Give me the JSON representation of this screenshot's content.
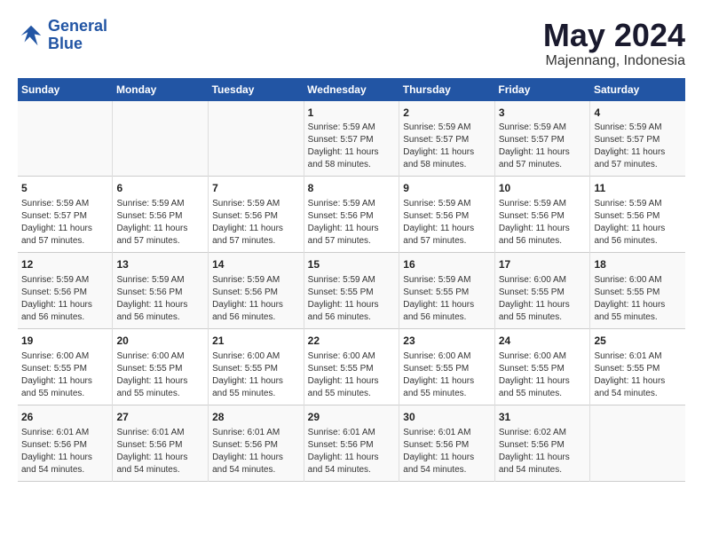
{
  "header": {
    "logo_line1": "General",
    "logo_line2": "Blue",
    "month_title": "May 2024",
    "location": "Majennang, Indonesia"
  },
  "weekdays": [
    "Sunday",
    "Monday",
    "Tuesday",
    "Wednesday",
    "Thursday",
    "Friday",
    "Saturday"
  ],
  "weeks": [
    {
      "cells": [
        {
          "day": "",
          "info": ""
        },
        {
          "day": "",
          "info": ""
        },
        {
          "day": "",
          "info": ""
        },
        {
          "day": "1",
          "info": "Sunrise: 5:59 AM\nSunset: 5:57 PM\nDaylight: 11 hours\nand 58 minutes."
        },
        {
          "day": "2",
          "info": "Sunrise: 5:59 AM\nSunset: 5:57 PM\nDaylight: 11 hours\nand 58 minutes."
        },
        {
          "day": "3",
          "info": "Sunrise: 5:59 AM\nSunset: 5:57 PM\nDaylight: 11 hours\nand 57 minutes."
        },
        {
          "day": "4",
          "info": "Sunrise: 5:59 AM\nSunset: 5:57 PM\nDaylight: 11 hours\nand 57 minutes."
        }
      ]
    },
    {
      "cells": [
        {
          "day": "5",
          "info": "Sunrise: 5:59 AM\nSunset: 5:57 PM\nDaylight: 11 hours\nand 57 minutes."
        },
        {
          "day": "6",
          "info": "Sunrise: 5:59 AM\nSunset: 5:56 PM\nDaylight: 11 hours\nand 57 minutes."
        },
        {
          "day": "7",
          "info": "Sunrise: 5:59 AM\nSunset: 5:56 PM\nDaylight: 11 hours\nand 57 minutes."
        },
        {
          "day": "8",
          "info": "Sunrise: 5:59 AM\nSunset: 5:56 PM\nDaylight: 11 hours\nand 57 minutes."
        },
        {
          "day": "9",
          "info": "Sunrise: 5:59 AM\nSunset: 5:56 PM\nDaylight: 11 hours\nand 57 minutes."
        },
        {
          "day": "10",
          "info": "Sunrise: 5:59 AM\nSunset: 5:56 PM\nDaylight: 11 hours\nand 56 minutes."
        },
        {
          "day": "11",
          "info": "Sunrise: 5:59 AM\nSunset: 5:56 PM\nDaylight: 11 hours\nand 56 minutes."
        }
      ]
    },
    {
      "cells": [
        {
          "day": "12",
          "info": "Sunrise: 5:59 AM\nSunset: 5:56 PM\nDaylight: 11 hours\nand 56 minutes."
        },
        {
          "day": "13",
          "info": "Sunrise: 5:59 AM\nSunset: 5:56 PM\nDaylight: 11 hours\nand 56 minutes."
        },
        {
          "day": "14",
          "info": "Sunrise: 5:59 AM\nSunset: 5:56 PM\nDaylight: 11 hours\nand 56 minutes."
        },
        {
          "day": "15",
          "info": "Sunrise: 5:59 AM\nSunset: 5:55 PM\nDaylight: 11 hours\nand 56 minutes."
        },
        {
          "day": "16",
          "info": "Sunrise: 5:59 AM\nSunset: 5:55 PM\nDaylight: 11 hours\nand 56 minutes."
        },
        {
          "day": "17",
          "info": "Sunrise: 6:00 AM\nSunset: 5:55 PM\nDaylight: 11 hours\nand 55 minutes."
        },
        {
          "day": "18",
          "info": "Sunrise: 6:00 AM\nSunset: 5:55 PM\nDaylight: 11 hours\nand 55 minutes."
        }
      ]
    },
    {
      "cells": [
        {
          "day": "19",
          "info": "Sunrise: 6:00 AM\nSunset: 5:55 PM\nDaylight: 11 hours\nand 55 minutes."
        },
        {
          "day": "20",
          "info": "Sunrise: 6:00 AM\nSunset: 5:55 PM\nDaylight: 11 hours\nand 55 minutes."
        },
        {
          "day": "21",
          "info": "Sunrise: 6:00 AM\nSunset: 5:55 PM\nDaylight: 11 hours\nand 55 minutes."
        },
        {
          "day": "22",
          "info": "Sunrise: 6:00 AM\nSunset: 5:55 PM\nDaylight: 11 hours\nand 55 minutes."
        },
        {
          "day": "23",
          "info": "Sunrise: 6:00 AM\nSunset: 5:55 PM\nDaylight: 11 hours\nand 55 minutes."
        },
        {
          "day": "24",
          "info": "Sunrise: 6:00 AM\nSunset: 5:55 PM\nDaylight: 11 hours\nand 55 minutes."
        },
        {
          "day": "25",
          "info": "Sunrise: 6:01 AM\nSunset: 5:55 PM\nDaylight: 11 hours\nand 54 minutes."
        }
      ]
    },
    {
      "cells": [
        {
          "day": "26",
          "info": "Sunrise: 6:01 AM\nSunset: 5:56 PM\nDaylight: 11 hours\nand 54 minutes."
        },
        {
          "day": "27",
          "info": "Sunrise: 6:01 AM\nSunset: 5:56 PM\nDaylight: 11 hours\nand 54 minutes."
        },
        {
          "day": "28",
          "info": "Sunrise: 6:01 AM\nSunset: 5:56 PM\nDaylight: 11 hours\nand 54 minutes."
        },
        {
          "day": "29",
          "info": "Sunrise: 6:01 AM\nSunset: 5:56 PM\nDaylight: 11 hours\nand 54 minutes."
        },
        {
          "day": "30",
          "info": "Sunrise: 6:01 AM\nSunset: 5:56 PM\nDaylight: 11 hours\nand 54 minutes."
        },
        {
          "day": "31",
          "info": "Sunrise: 6:02 AM\nSunset: 5:56 PM\nDaylight: 11 hours\nand 54 minutes."
        },
        {
          "day": "",
          "info": ""
        }
      ]
    }
  ]
}
